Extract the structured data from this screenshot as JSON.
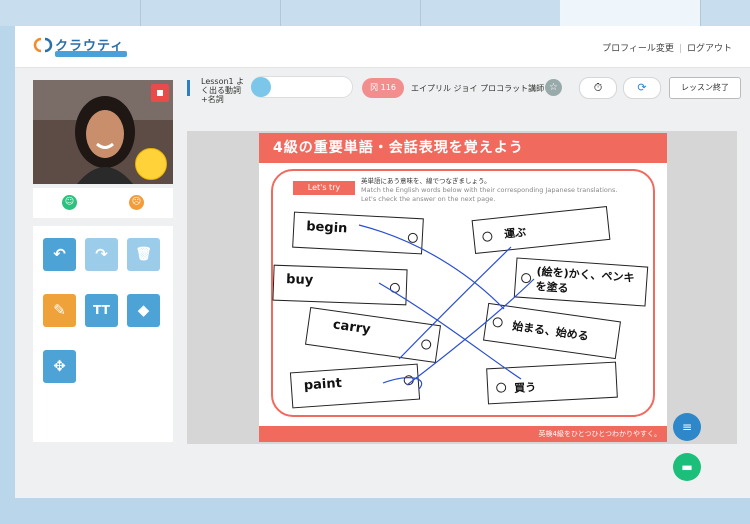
{
  "header": {
    "logo_text": "クラウティ",
    "profile_link": "プロフィール変更",
    "separator": "|",
    "logout_link": "ログアウト"
  },
  "lesson": {
    "title": "Lesson1 よく出る動詞+名詞",
    "badge": "冈 116",
    "teacher": "エイプリル ジョイ プロコラット講師",
    "end_button": "レッスン終了"
  },
  "icons": {
    "star": "☆",
    "timer": "⏱",
    "refresh": "⟳",
    "undo": "↶",
    "redo": "↷",
    "trash": "🗑",
    "pen": "✎",
    "text": "TT",
    "eraser": "◆",
    "move": "✥",
    "doc": "≡",
    "chat": "▬",
    "happy": "☺",
    "sad": "☹"
  },
  "worksheet": {
    "heading": "4級の重要単語・会話表現を覚えよう",
    "try_label": "Let's try",
    "instruction_ja": "英単語にあう意味を、線でつなぎましょう。",
    "instruction_en_1": "Match the English words below with their corresponding Japanese translations.",
    "instruction_en_2": "Let's check the answer on the next page.",
    "english_words": [
      "begin",
      "buy",
      "carry",
      "paint"
    ],
    "japanese_words": [
      "運ぶ",
      "(絵を)かく、ペンキを塗る",
      "始まる、始める",
      "買う"
    ],
    "footer": "英検4級をひとつひとつわかりやすく。"
  },
  "colors": {
    "accent_red": "#f06a5e",
    "tool_blue": "#4da3d6",
    "tool_orange": "#f0a23a",
    "fab_blue": "#2d87c8",
    "fab_green": "#1bbf7a"
  }
}
